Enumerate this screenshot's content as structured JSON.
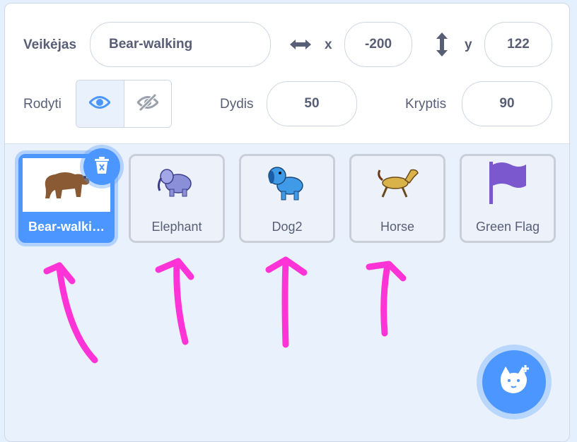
{
  "sprite_info": {
    "sprite_label": "Veikėjas",
    "sprite_name": "Bear-walking",
    "x_label": "x",
    "x_value": "-200",
    "y_label": "y",
    "y_value": "122",
    "show_label": "Rodyti",
    "size_label": "Dydis",
    "size_value": "50",
    "direction_label": "Kryptis",
    "direction_value": "90"
  },
  "sprites": [
    {
      "name": "Bear-walki…",
      "icon": "bear-icon",
      "selected": true
    },
    {
      "name": "Elephant",
      "icon": "elephant-icon"
    },
    {
      "name": "Dog2",
      "icon": "dog-icon"
    },
    {
      "name": "Horse",
      "icon": "horse-icon"
    },
    {
      "name": "Green Flag",
      "icon": "flag-icon"
    }
  ],
  "colors": {
    "accent": "#4c97ff",
    "text": "#575e75",
    "annotation_arrow": "#ff33d6",
    "flag": "#7c58cf"
  }
}
